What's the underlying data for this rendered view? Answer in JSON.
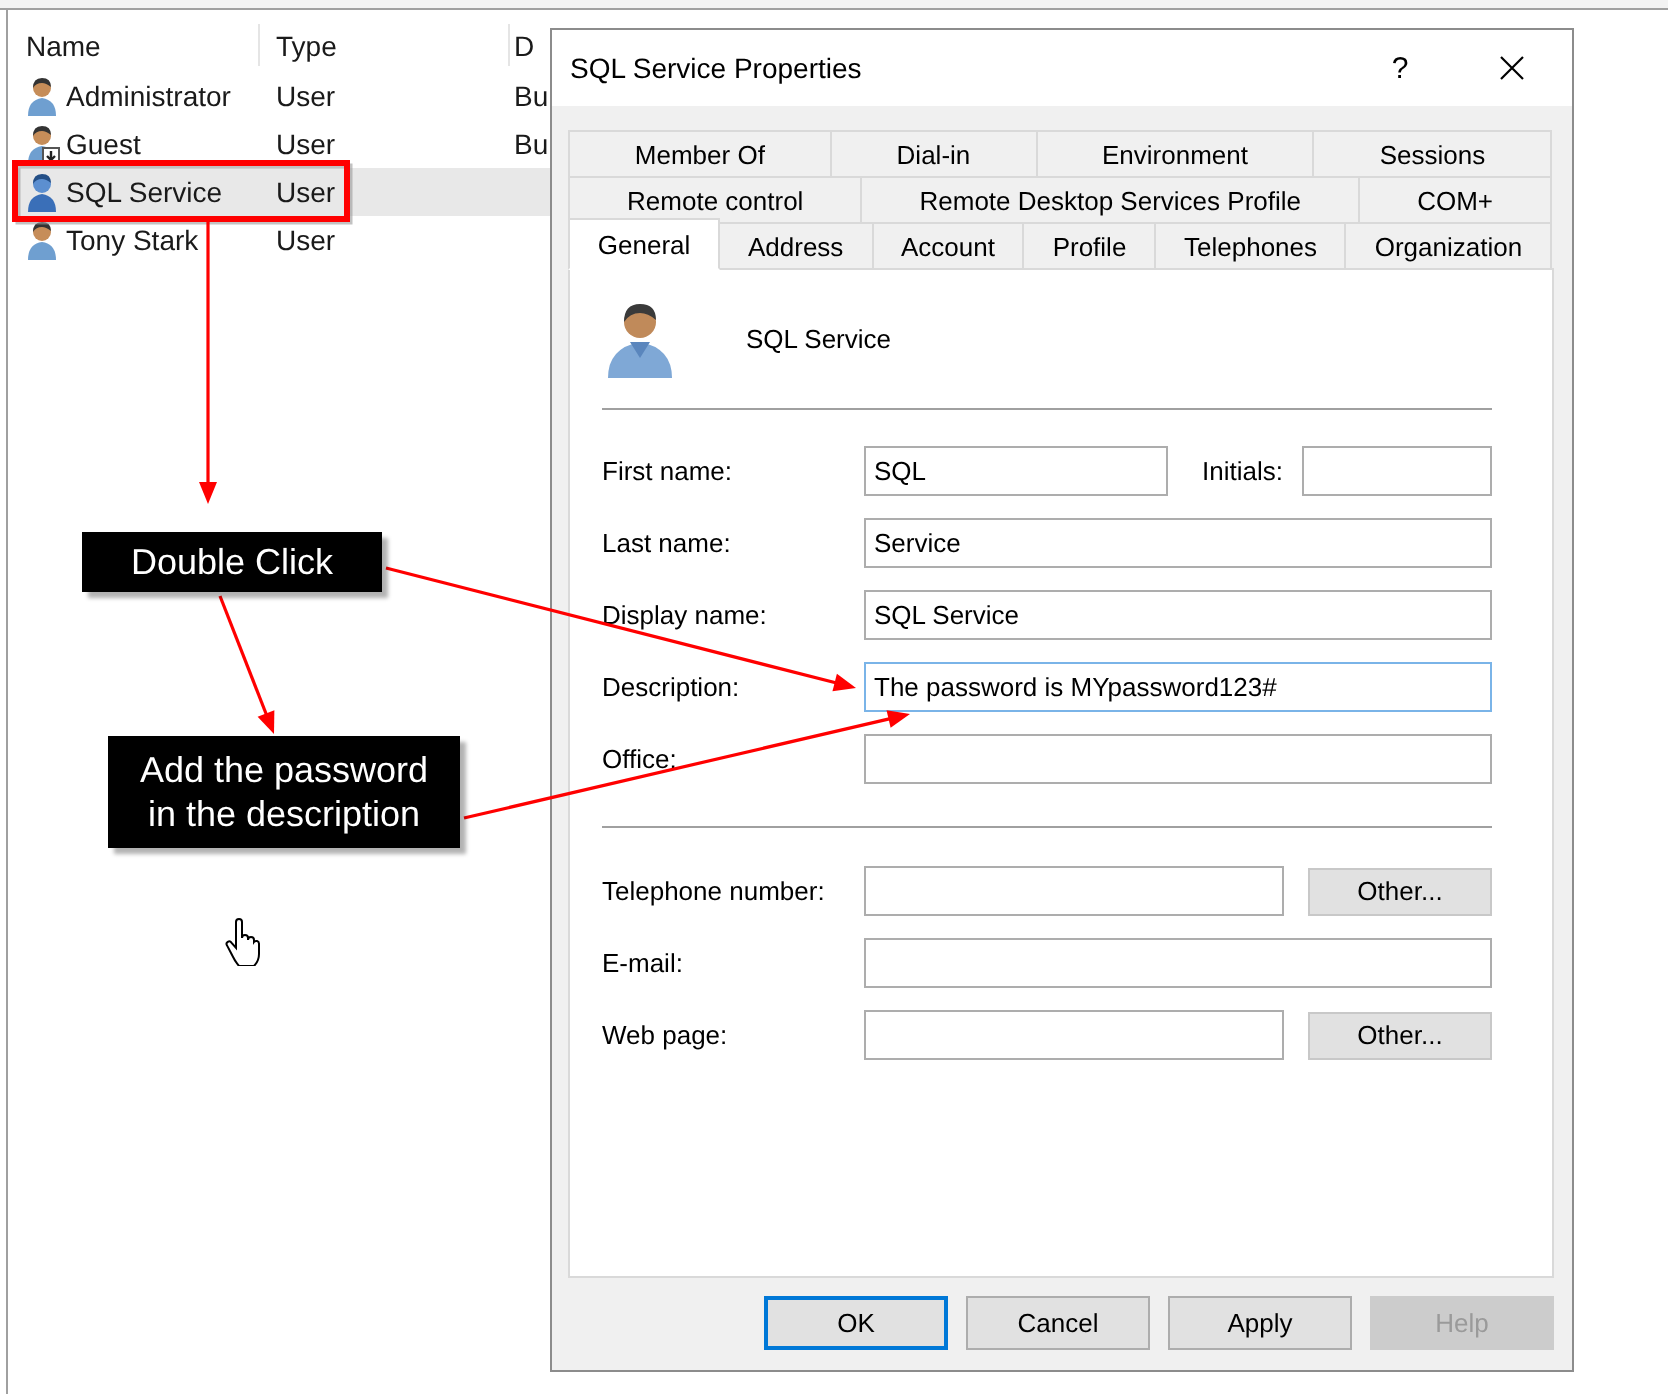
{
  "list": {
    "columns": [
      {
        "label": "Name"
      },
      {
        "label": "Type"
      },
      {
        "label": "D"
      }
    ],
    "rows": [
      {
        "name": "Administrator",
        "type": "User",
        "column_3": "Bu",
        "disabled": false,
        "selected": false
      },
      {
        "name": "Guest",
        "type": "User",
        "column_3": "Bu",
        "disabled": true,
        "selected": false
      },
      {
        "name": "SQL Service",
        "type": "User",
        "disabled": false,
        "selected": true
      },
      {
        "name": "Tony Stark",
        "type": "User",
        "disabled": false,
        "selected": false
      }
    ]
  },
  "dialog": {
    "title": "SQL Service Properties",
    "help_button": "?",
    "tab_rows": [
      {
        "tabs": [
          {
            "label": "Member Of",
            "selected": false
          },
          {
            "label": "Dial-in",
            "selected": false
          },
          {
            "label": "Environment",
            "selected": false
          },
          {
            "label": "Sessions",
            "selected": false
          }
        ]
      },
      {
        "tabs": [
          {
            "label": "Remote control",
            "selected": false
          },
          {
            "label": "Remote Desktop Services Profile",
            "selected": false
          },
          {
            "label": "COM+",
            "selected": false
          }
        ]
      },
      {
        "tabs": [
          {
            "label": "General",
            "selected": true
          },
          {
            "label": "Address",
            "selected": false
          },
          {
            "label": "Account",
            "selected": false
          },
          {
            "label": "Profile",
            "selected": false
          },
          {
            "label": "Telephones",
            "selected": false
          },
          {
            "label": "Organization",
            "selected": false
          }
        ]
      }
    ],
    "account_name": "SQL Service",
    "field_groups": [
      {
        "fields": [
          {
            "kind": "split",
            "label": "First name:",
            "value": "SQL",
            "side_label": "Initials:",
            "focused": false
          },
          {
            "kind": "full",
            "label": "Last name:",
            "value": "Service",
            "focused": false
          },
          {
            "kind": "full",
            "label": "Display name:",
            "value": "SQL Service",
            "focused": false
          },
          {
            "kind": "full",
            "label": "Description:",
            "value": "The password is MYpassword123#",
            "focused": true
          },
          {
            "kind": "full",
            "label": "Office:",
            "focused": false
          }
        ]
      },
      {
        "fields": [
          {
            "kind": "button",
            "label": "Telephone number:",
            "button": "Other...",
            "focused": false
          },
          {
            "kind": "full",
            "label": "E-mail:",
            "focused": false
          },
          {
            "kind": "button",
            "label": "Web page:",
            "button": "Other...",
            "focused": false
          }
        ]
      }
    ],
    "buttons": [
      {
        "label": "OK",
        "default": true,
        "disabled": false
      },
      {
        "label": "Cancel",
        "default": false,
        "disabled": false
      },
      {
        "label": "Apply",
        "default": false,
        "disabled": false
      },
      {
        "label": "Help",
        "default": false,
        "disabled": true
      }
    ]
  },
  "annotations": {
    "callouts": [
      {
        "text": "Double Click"
      },
      {
        "text": "Add the password in the description"
      }
    ]
  }
}
